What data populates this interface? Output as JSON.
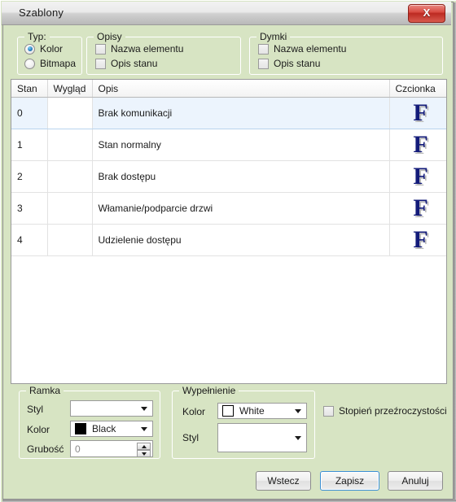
{
  "window": {
    "title": "Szablony",
    "close_icon": "close-icon",
    "close_label": "X"
  },
  "type_group": {
    "label": "Typ:",
    "options": [
      {
        "label": "Kolor",
        "selected": true
      },
      {
        "label": "Bitmapa",
        "selected": false
      }
    ]
  },
  "captions_group": {
    "label": "Opisy",
    "options": [
      {
        "label": "Nazwa elementu",
        "checked": false
      },
      {
        "label": "Opis stanu",
        "checked": false
      }
    ]
  },
  "tooltips_group": {
    "label": "Dymki",
    "options": [
      {
        "label": "Nazwa elementu",
        "checked": false
      },
      {
        "label": "Opis stanu",
        "checked": false
      }
    ]
  },
  "table": {
    "columns": [
      "Stan",
      "Wygląd",
      "Opis",
      "Czcionka"
    ],
    "rows": [
      {
        "stan": "0",
        "opis": "Brak komunikacji",
        "czcionka": "F",
        "selected": true
      },
      {
        "stan": "1",
        "opis": "Stan normalny",
        "czcionka": "F",
        "selected": false
      },
      {
        "stan": "2",
        "opis": "Brak dostępu",
        "czcionka": "F",
        "selected": false
      },
      {
        "stan": "3",
        "opis": "Włamanie/podparcie drzwi",
        "czcionka": "F",
        "selected": false
      },
      {
        "stan": "4",
        "opis": "Udzielenie dostępu",
        "czcionka": "F",
        "selected": false
      }
    ]
  },
  "frame_group": {
    "label": "Ramka",
    "style_label": "Styl",
    "style_value": "",
    "color_label": "Kolor",
    "color_value": "Black",
    "color_hex": "#000000",
    "thickness_label": "Grubość",
    "thickness_value": "0"
  },
  "fill_group": {
    "label": "Wypełnienie",
    "color_label": "Kolor",
    "color_value": "White",
    "color_hex": "#ffffff",
    "style_label": "Styl",
    "style_value": ""
  },
  "transparency": {
    "label": "Stopień przeźroczystości",
    "checked": false
  },
  "footer": {
    "back_label": "Wstecz",
    "save_label": "Zapisz",
    "cancel_label": "Anuluj"
  },
  "colors": {
    "client_background": "#d7e4c3",
    "selection": "#ecf4fd",
    "font_glyph": "#131b7a",
    "close_button": "#bc2a22",
    "default_button_border": "#3c8fd4"
  }
}
